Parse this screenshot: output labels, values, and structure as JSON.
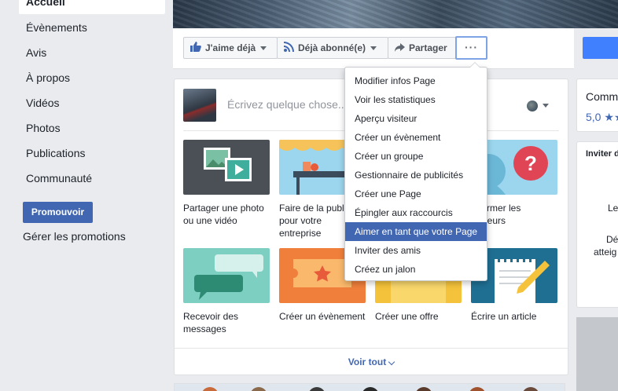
{
  "sidebar": {
    "items": [
      {
        "label": "Accueil",
        "active": true
      },
      {
        "label": "Évènements"
      },
      {
        "label": "Avis"
      },
      {
        "label": "À propos"
      },
      {
        "label": "Vidéos"
      },
      {
        "label": "Photos"
      },
      {
        "label": "Publications"
      },
      {
        "label": "Communauté"
      }
    ],
    "promote_label": "Promouvoir",
    "manage_promotions_label": "Gérer les promotions"
  },
  "action_bar": {
    "like_label": "J'aime déjà",
    "subscribed_label": "Déjà abonné(e)",
    "share_label": "Partager",
    "more_label": "···"
  },
  "composer": {
    "placeholder": "Écrivez quelque chose...",
    "tiles": [
      {
        "label": "Partager une photo ou une vidéo"
      },
      {
        "label": "Faire de la publicité pour votre entreprise"
      },
      {
        "label": "Informer les visiteurs"
      },
      {
        "label": "Recevoir des messages"
      },
      {
        "label": "Créer un évènement"
      },
      {
        "label": "Créer une offre"
      },
      {
        "label": "Écrire un article"
      }
    ],
    "see_all_label": "Voir tout"
  },
  "menu": {
    "items": [
      {
        "label": "Modifier infos Page"
      },
      {
        "label": "Voir les statistiques"
      },
      {
        "label": "Aperçu visiteur"
      },
      {
        "label": "Créer un évènement"
      },
      {
        "label": "Créer un groupe"
      },
      {
        "label": "Gestionnaire de publicités"
      },
      {
        "label": "Créer une Page"
      },
      {
        "label": "Épingler aux raccourcis"
      },
      {
        "label": "Aimer en tant que votre Page",
        "highlighted": true
      },
      {
        "label": "Inviter des amis"
      },
      {
        "label": "Créez un jalon"
      }
    ]
  },
  "right": {
    "card1_title": "Comm",
    "card1_rating": "5,0 ★★",
    "card2_title": "Inviter d",
    "card2_line1": "Le",
    "card2_line2": "Dé",
    "card2_line3": "atteig"
  },
  "colors": {
    "brand": "#4267b2",
    "accent_blue": "#4080ff",
    "background": "#e9ebee"
  }
}
